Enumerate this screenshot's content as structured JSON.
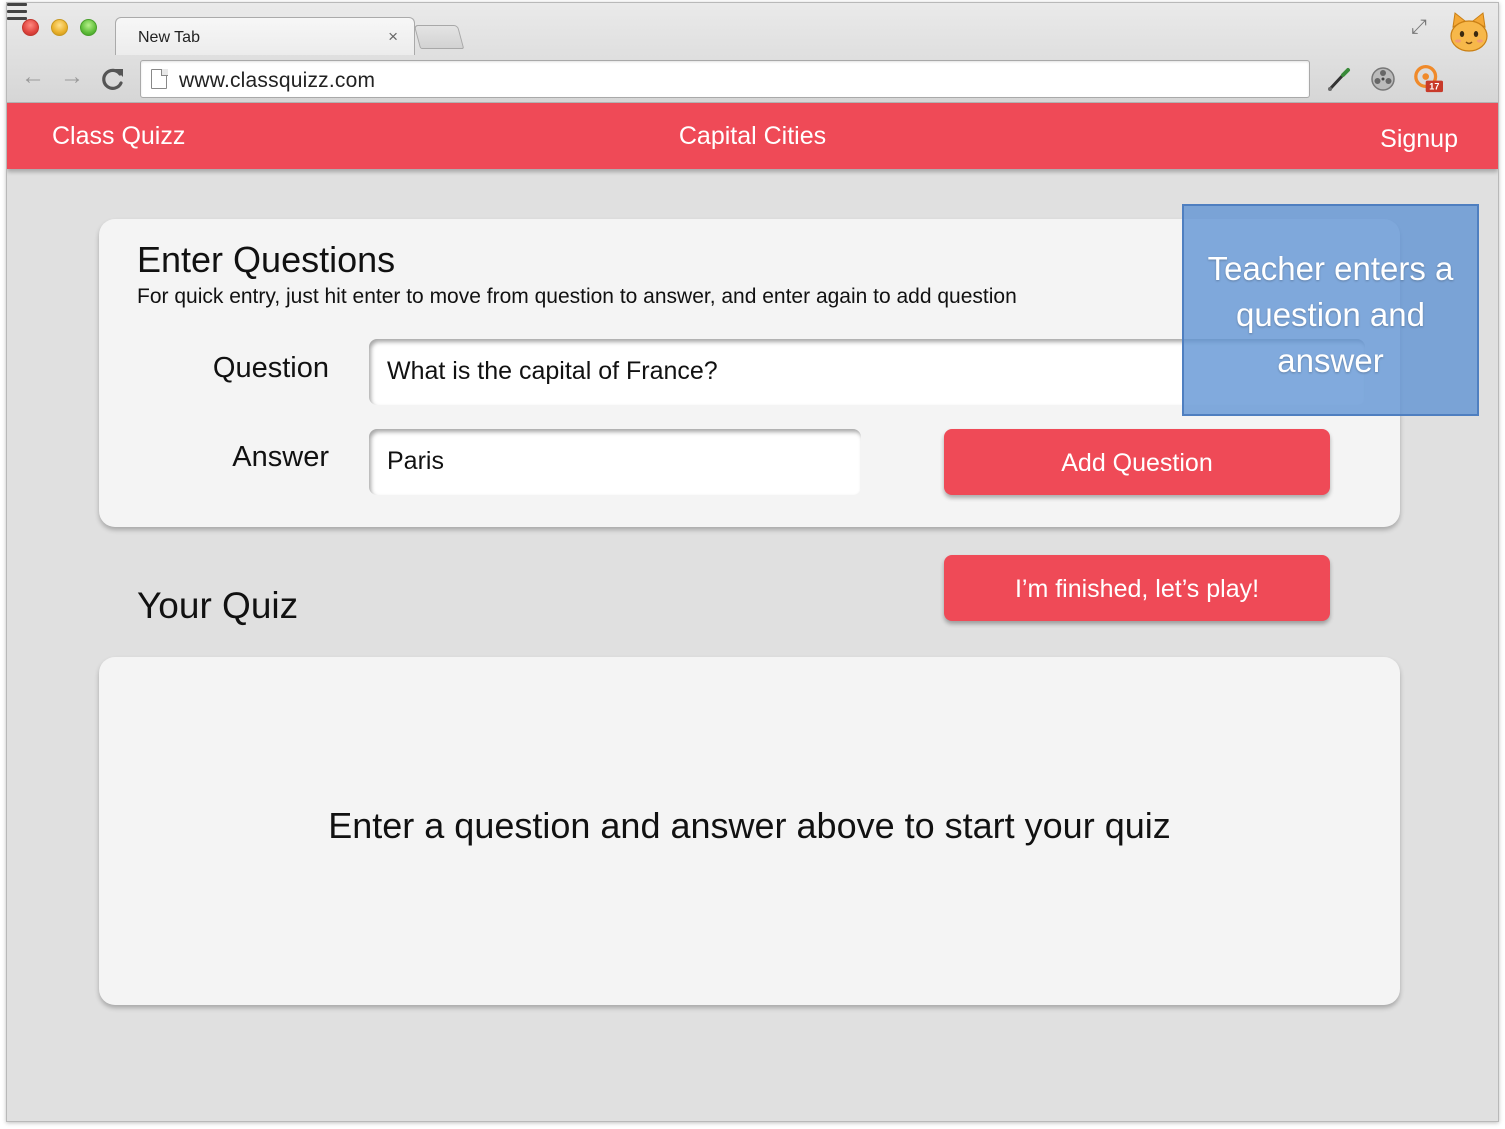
{
  "browser": {
    "tab_title": "New Tab",
    "tab_close": "×",
    "url": "www.classquizz.com",
    "nav": {
      "back": "←",
      "forward": "→",
      "reload": "C"
    },
    "fullscreen_glyph": "⤢",
    "extension_badge_count": "17",
    "icons": [
      "close-icon",
      "fullscreen-icon",
      "cat-avatar-icon",
      "back-arrow-icon",
      "forward-arrow-icon",
      "reload-icon",
      "page-icon",
      "eyedropper-icon",
      "film-reel-icon",
      "rss-badge-icon",
      "hamburger-menu-icon"
    ]
  },
  "app": {
    "brand": "Class Quizz",
    "quiz_title": "Capital Cities",
    "signup": "Signup",
    "accent_color": "#ef4a57"
  },
  "enter_questions": {
    "heading": "Enter Questions",
    "hint": "For quick entry, just hit enter to move from question to answer, and enter again to add question",
    "question_label": "Question",
    "question_value": "What is the capital of France?",
    "answer_label": "Answer",
    "answer_value": "Paris",
    "add_button": "Add Question"
  },
  "your_quiz": {
    "heading": "Your Quiz",
    "play_button": "I’m finished, let’s play!",
    "empty_message": "Enter a question and answer above to start your quiz"
  },
  "callout": {
    "text_lines": [
      "Teacher enters a",
      "question and",
      "answer"
    ],
    "color": "#5d92d4"
  }
}
